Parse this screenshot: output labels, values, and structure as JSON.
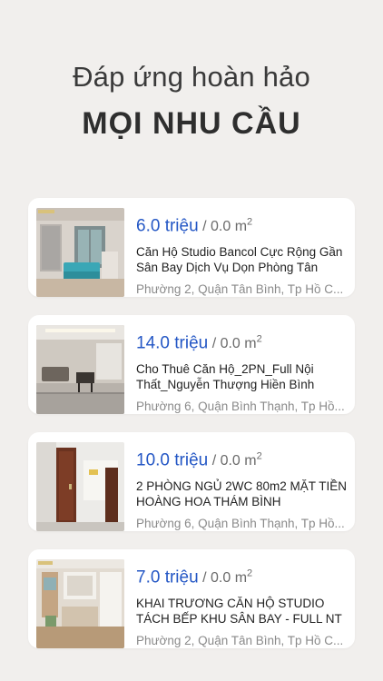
{
  "hero": {
    "line1": "Đáp ứng hoàn hảo",
    "line2": "MỌI NHU CẦU"
  },
  "listings": [
    {
      "price": "6.0 triệu",
      "area": "/ 0.0 m",
      "area_sup": "2",
      "title": "Căn Hộ Studio Bancol Cực Rộng Gần Sân Bay Dịch Vụ Dọn Phòng Tân",
      "address": "Phường 2, Quận Tân Bình, Tp Hồ C..."
    },
    {
      "price": "14.0 triệu",
      "area": "/ 0.0 m",
      "area_sup": "2",
      "title": "Cho Thuê Căn Hộ_2PN_Full Nội Thất_Nguyễn Thượng Hiền Bình",
      "address": "Phường 6, Quận Bình Thạnh, Tp Hồ..."
    },
    {
      "price": "10.0 triệu",
      "area": "/ 0.0 m",
      "area_sup": "2",
      "title": "2 PHÒNG NGỦ 2WC 80m2 MẶT TIỀN HOÀNG HOA THÁM BÌNH",
      "address": "Phường 6, Quận Bình Thạnh, Tp Hồ..."
    },
    {
      "price": "7.0 triệu",
      "area": "/ 0.0 m",
      "area_sup": "2",
      "title": "KHAI TRƯƠNG CĂN HỘ STUDIO TÁCH BẾP KHU SÂN BAY - FULL NT",
      "address": "Phường 2, Quận Tân Bình, Tp Hồ C..."
    }
  ],
  "colors": {
    "background": "#f1efed",
    "card": "#ffffff",
    "price": "#2457c5",
    "address": "#8a8a8a"
  }
}
